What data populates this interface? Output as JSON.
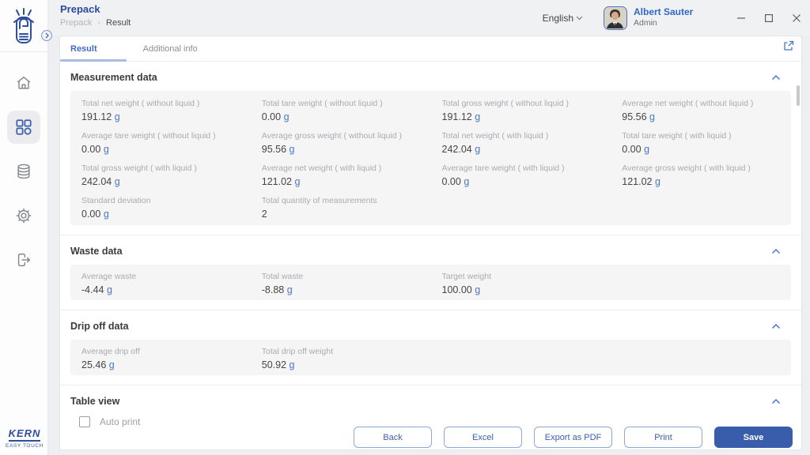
{
  "app": {
    "title": "Prepack",
    "breadcrumb": [
      "Prepack",
      "Result"
    ],
    "language": "English",
    "user": {
      "name": "Albert Sauter",
      "role": "Admin"
    },
    "brand": {
      "name": "KERN",
      "tagline": "EASY TOUCH"
    }
  },
  "colors": {
    "primary": "#2d4f9e",
    "accent": "#4a76c9",
    "save_button": "#3a5dab",
    "label_gray": "#a8abb0",
    "panel_bg": "#f5f5f6"
  },
  "sidebar": {
    "items": [
      "home",
      "apps",
      "database",
      "settings",
      "logout"
    ],
    "active_item": "apps"
  },
  "tabs": [
    {
      "label": "Result",
      "state": "active"
    },
    {
      "label": "Additional info",
      "state": "inactive"
    }
  ],
  "sections": {
    "measurement": {
      "title": "Measurement data",
      "fields": [
        {
          "label": "Total net weight ( without liquid )",
          "value": "191.12",
          "unit": "g"
        },
        {
          "label": "Total tare weight ( without liquid )",
          "value": "0.00",
          "unit": "g"
        },
        {
          "label": "Total gross weight ( without liquid )",
          "value": "191.12",
          "unit": "g"
        },
        {
          "label": "Average net weight ( without liquid )",
          "value": "95.56",
          "unit": "g"
        },
        {
          "label": "Average tare weight ( without liquid )",
          "value": "0.00",
          "unit": "g"
        },
        {
          "label": "Average gross weight ( without liquid )",
          "value": "95.56",
          "unit": "g"
        },
        {
          "label": "Total net weight ( with liquid )",
          "value": "242.04",
          "unit": "g"
        },
        {
          "label": "Total tare weight ( with liquid )",
          "value": "0.00",
          "unit": "g"
        },
        {
          "label": "Total gross weight ( with liquid )",
          "value": "242.04",
          "unit": "g"
        },
        {
          "label": "Average net weight ( with liquid )",
          "value": "121.02",
          "unit": "g"
        },
        {
          "label": "Average tare weight ( with liquid )",
          "value": "0.00",
          "unit": "g"
        },
        {
          "label": "Average gross weight ( with liquid )",
          "value": "121.02",
          "unit": "g"
        },
        {
          "label": "Standard deviation",
          "value": "0.00",
          "unit": "g"
        },
        {
          "label": "Total quantity of measurements",
          "value": "2",
          "unit": ""
        }
      ]
    },
    "waste": {
      "title": "Waste data",
      "fields": [
        {
          "label": "Average waste",
          "value": "-4.44",
          "unit": "g"
        },
        {
          "label": "Total waste",
          "value": "-8.88",
          "unit": "g"
        },
        {
          "label": "Target weight",
          "value": "100.00",
          "unit": "g"
        }
      ]
    },
    "dripoff": {
      "title": "Drip off data",
      "fields": [
        {
          "label": "Average drip off",
          "value": "25.46",
          "unit": "g"
        },
        {
          "label": "Total drip off weight",
          "value": "50.92",
          "unit": "g"
        }
      ]
    },
    "tableview": {
      "title": "Table view",
      "checkbox_label": "Auto print",
      "checked": false
    }
  },
  "footer_buttons": [
    {
      "label": "Back",
      "style": "outline"
    },
    {
      "label": "Excel",
      "style": "outline"
    },
    {
      "label": "Export as PDF",
      "style": "outline"
    },
    {
      "label": "Print",
      "style": "outline"
    },
    {
      "label": "Save",
      "style": "primary"
    }
  ]
}
